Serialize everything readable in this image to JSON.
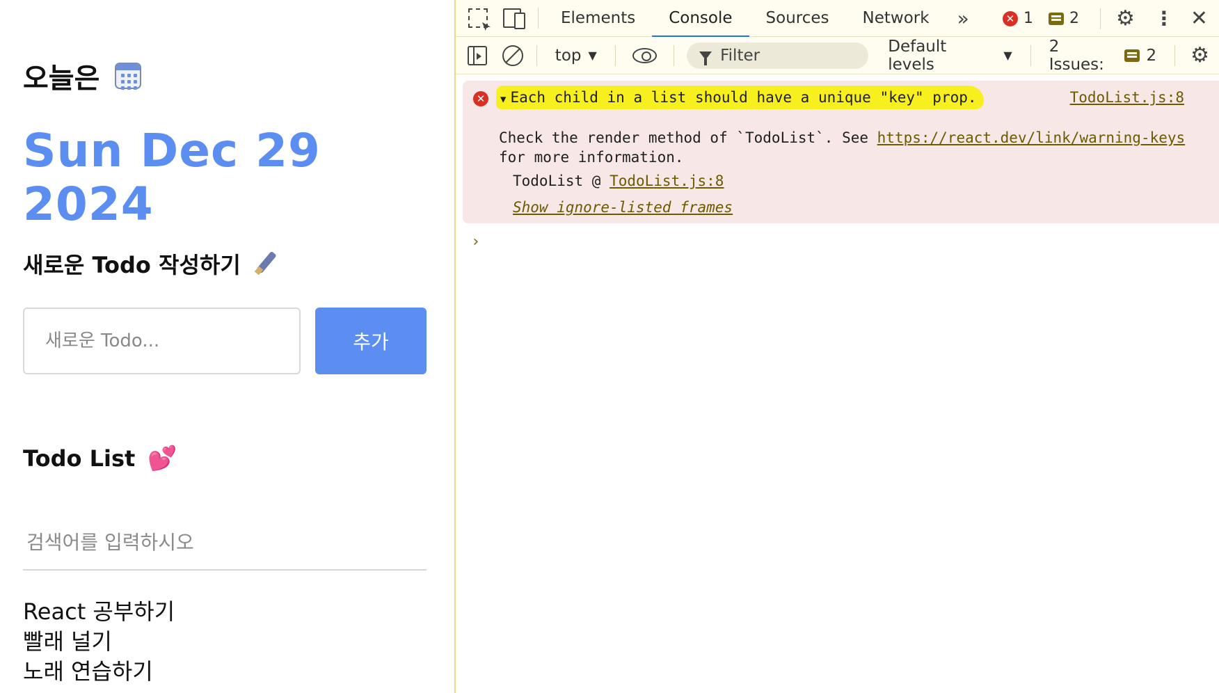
{
  "app": {
    "title": "오늘은",
    "date": "Sun Dec 29 2024",
    "new_todo_title": "새로운 Todo 작성하기",
    "new_todo_placeholder": "새로운 Todo...",
    "add_button": "추가",
    "list_title": "Todo List",
    "search_placeholder": "검색어를 입력하시오",
    "todos": [
      "React 공부하기",
      "빨래 널기",
      "노래 연습하기"
    ],
    "accent_color": "#5b8ef0"
  },
  "devtools": {
    "tabs": [
      "Elements",
      "Console",
      "Sources",
      "Network"
    ],
    "active_tab": "Console",
    "error_count": "1",
    "message_count": "2",
    "context": "top",
    "filter_placeholder": "Filter",
    "levels": "Default levels",
    "issues_label": "2 Issues:",
    "issues_count": "2",
    "console": {
      "error_message": "Each child in a list should have a unique \"key\" prop.",
      "source": "TodoList.js:8",
      "body_text_1": "Check the render method of `TodoList`. See ",
      "link": "https://react.dev/link/warning-keys",
      "body_text_2": " for more information.",
      "stack_fn": "TodoList @ ",
      "stack_source": "TodoList.js:8",
      "show_frames": "Show ignore-listed frames",
      "prompt": "›"
    },
    "icons": [
      "inspect-icon",
      "device-toolbar-icon",
      "more-tabs-icon",
      "error-icon",
      "message-icon",
      "gear-icon",
      "kebab-menu-icon",
      "close-icon",
      "sidebar-toggle-icon",
      "clear-console-icon",
      "eye-icon",
      "filter-icon"
    ]
  }
}
